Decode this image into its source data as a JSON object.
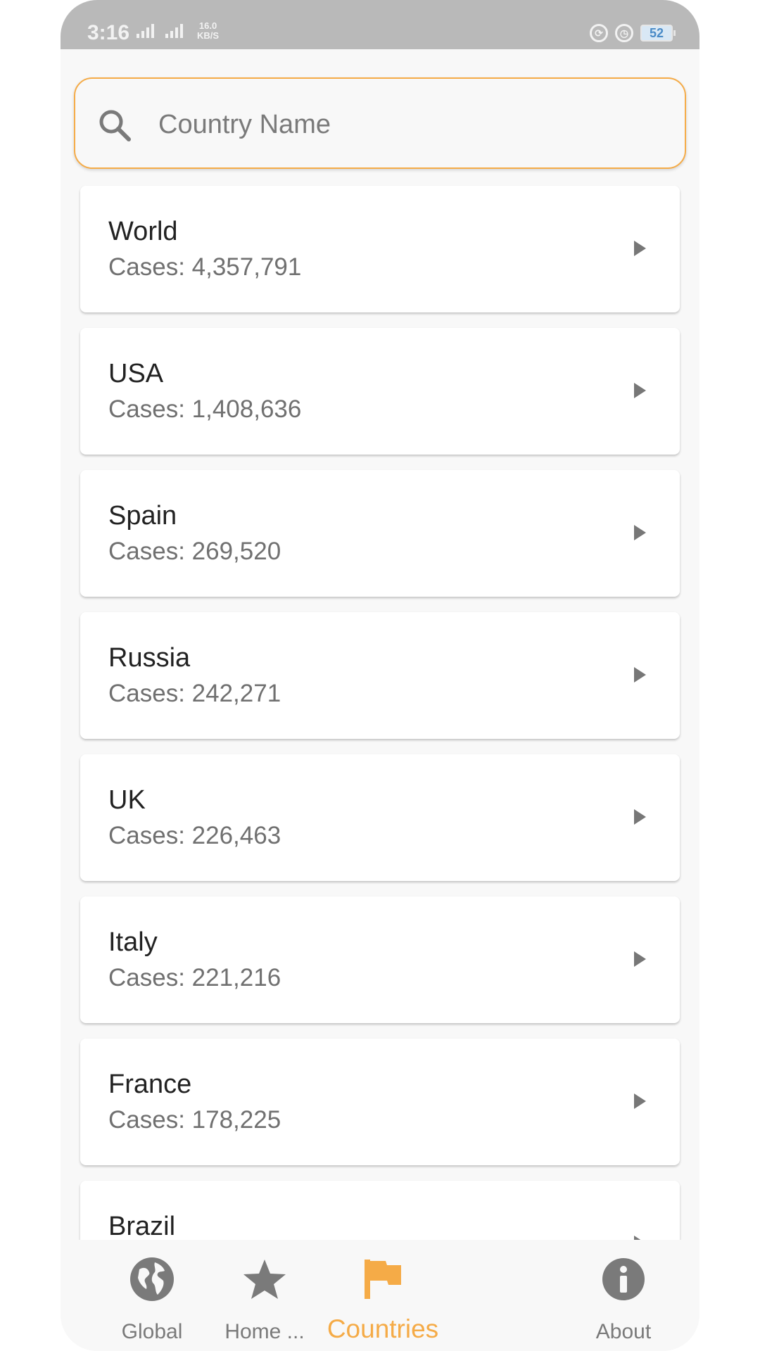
{
  "status_bar": {
    "time": "3:16",
    "network": "4G",
    "speed_value": "16.0",
    "speed_unit": "KB/S",
    "battery": "52"
  },
  "search": {
    "placeholder": "Country Name",
    "value": ""
  },
  "countries": [
    {
      "name": "World",
      "cases": "Cases: 4,357,791"
    },
    {
      "name": "USA",
      "cases": "Cases: 1,408,636"
    },
    {
      "name": "Spain",
      "cases": "Cases: 269,520"
    },
    {
      "name": "Russia",
      "cases": "Cases: 242,271"
    },
    {
      "name": "UK",
      "cases": "Cases: 226,463"
    },
    {
      "name": "Italy",
      "cases": "Cases: 221,216"
    },
    {
      "name": "France",
      "cases": "Cases: 178,225"
    },
    {
      "name": "Brazil",
      "cases": ""
    }
  ],
  "bottom_nav": {
    "items": [
      {
        "label": "Global",
        "icon": "globe-icon"
      },
      {
        "label": "Home ...",
        "icon": "star-icon"
      },
      {
        "label": "Countries",
        "icon": "flag-icon",
        "active": true
      },
      {
        "label": "About",
        "icon": "info-icon"
      }
    ]
  },
  "colors": {
    "accent": "#f5ab47",
    "icon_gray": "#7a7a7a",
    "status_bar": "#b9b9b9"
  }
}
